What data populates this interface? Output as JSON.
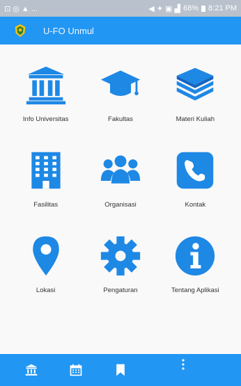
{
  "status_bar": {
    "left_indicators": "⊡ ◎ ▲ ...",
    "right_indicators": "◀ ✦ ▣ ▟",
    "battery": "68%",
    "time": "8:21 PM"
  },
  "app_bar": {
    "title": "U-FO Unmul",
    "logo_icon": "university-crest-icon"
  },
  "menu": [
    {
      "label": "Info Universitas",
      "icon": "university-building-icon"
    },
    {
      "label": "Fakultas",
      "icon": "graduation-cap-icon"
    },
    {
      "label": "Materi Kuliah",
      "icon": "stacked-layers-icon"
    },
    {
      "label": "Fasilitas",
      "icon": "building-icon"
    },
    {
      "label": "Organisasi",
      "icon": "people-group-icon"
    },
    {
      "label": "Kontak",
      "icon": "phone-icon"
    },
    {
      "label": "Lokasi",
      "icon": "map-pin-icon"
    },
    {
      "label": "Pengaturan",
      "icon": "gear-icon"
    },
    {
      "label": "Tentang Aplikasi",
      "icon": "info-icon"
    }
  ],
  "bottom_nav": [
    {
      "icon": "university-building-icon"
    },
    {
      "icon": "calendar-icon"
    },
    {
      "icon": "bookmark-icon"
    },
    {
      "icon": "more-vertical-icon"
    }
  ],
  "colors": {
    "primary": "#2196f3",
    "icon_blue": "#1e88e5",
    "status_bar": "#b8c1cc"
  }
}
